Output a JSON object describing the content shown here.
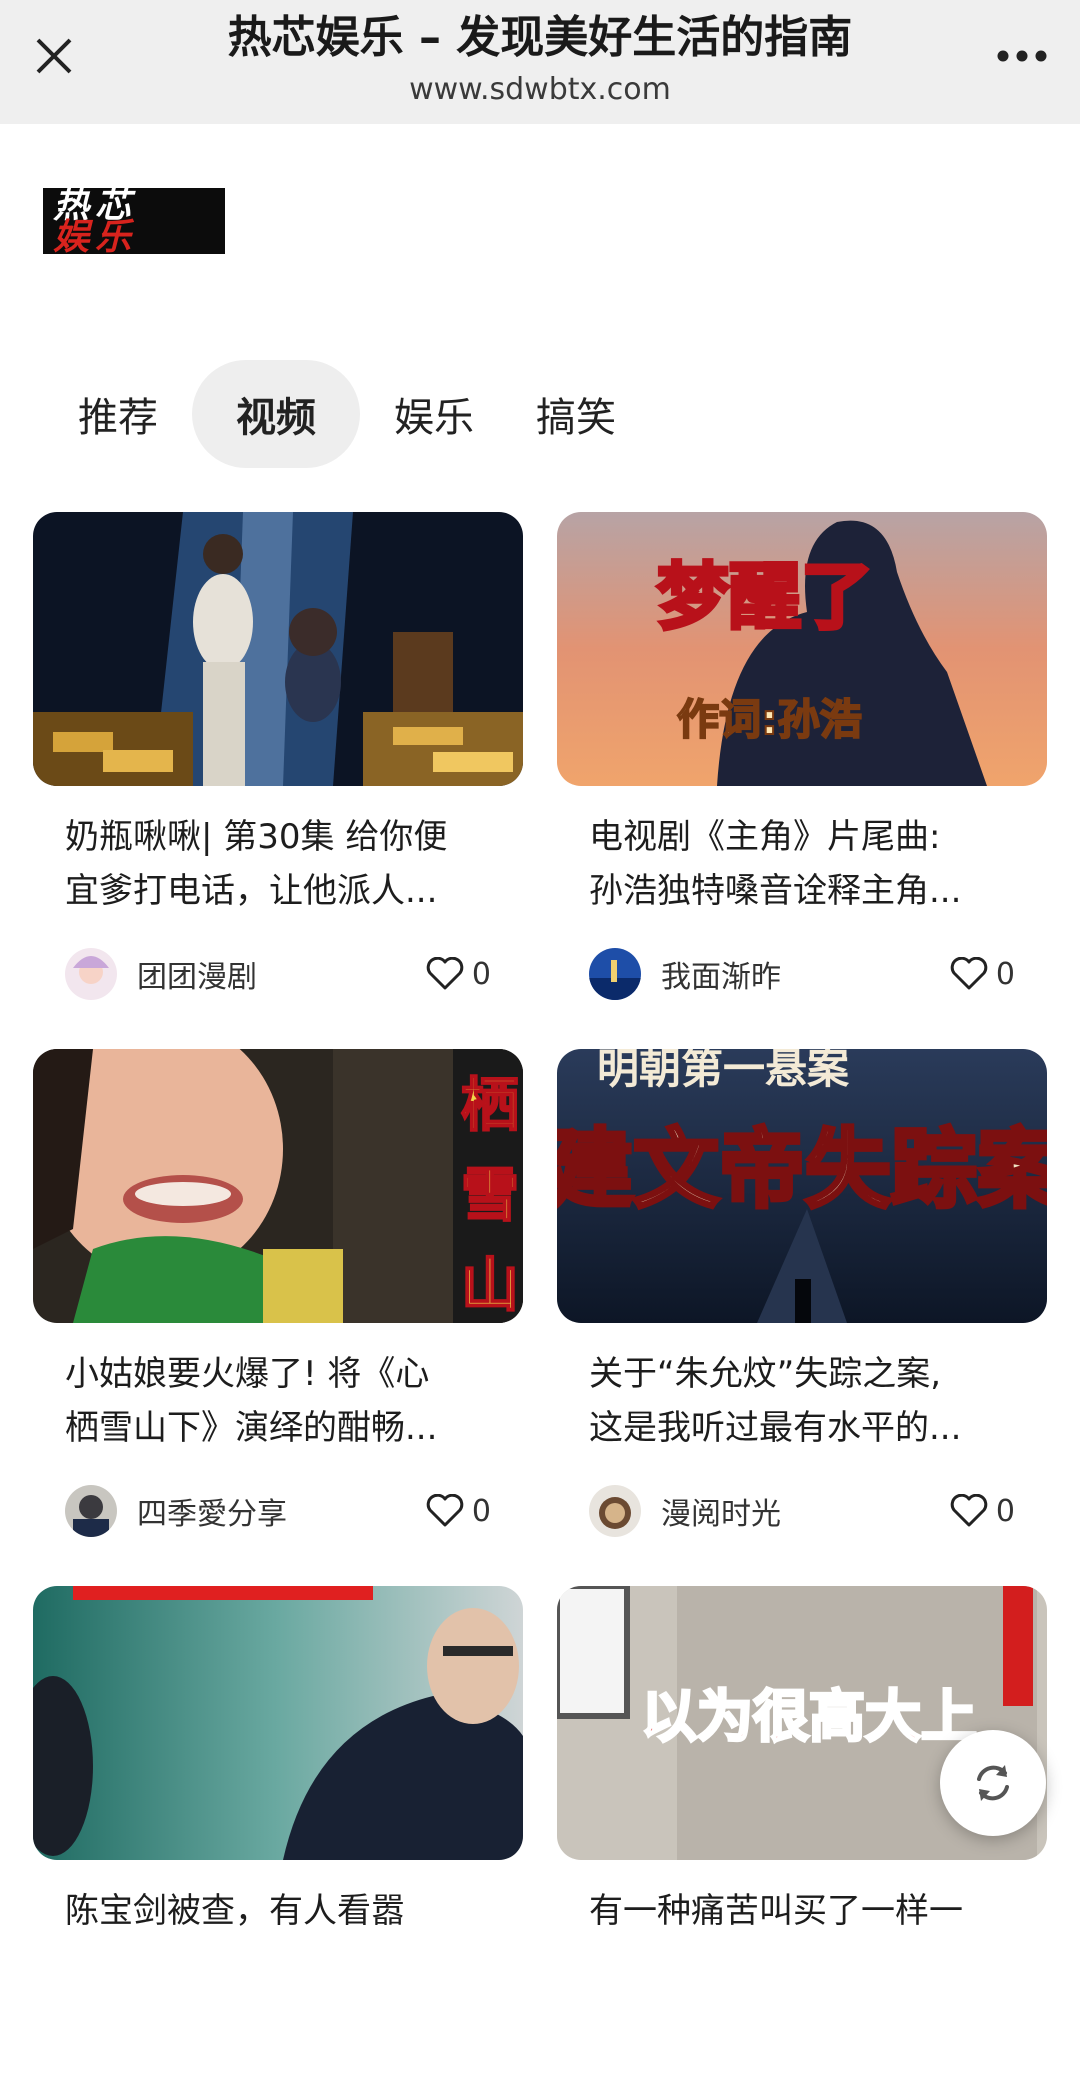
{
  "header": {
    "title": "热芯娱乐 – 发现美好生活的指南",
    "url": "www.sdwbtx.com",
    "close_icon": "close-icon",
    "more_icon": "more-dots-icon"
  },
  "logo": {
    "text_line1": "热芯",
    "text_line2": "娱乐"
  },
  "tabs": [
    {
      "label": "推荐",
      "active": false
    },
    {
      "label": "视频",
      "active": true
    },
    {
      "label": "娱乐",
      "active": false
    },
    {
      "label": "搞笑",
      "active": false
    }
  ],
  "cards": [
    {
      "title_line1": "奶瓶啾啾| 第30集 给你便",
      "title_line2": "宜爹打电话，让他派人...",
      "author": "团团漫剧",
      "likes": "0",
      "thumb_text": ""
    },
    {
      "title_line1": "电视剧《主角》片尾曲:",
      "title_line2": "孙浩独特嗓音诠释主角...",
      "author": "我面渐昨",
      "likes": "0",
      "thumb_text": "梦醒了",
      "thumb_subtext": "作词:孙浩"
    },
    {
      "title_line1": "小姑娘要火爆了! 将《心",
      "title_line2": "栖雪山下》演绎的酣畅...",
      "author": "四季愛分享",
      "likes": "0",
      "thumb_text": "栖雪山"
    },
    {
      "title_line1": "关于“朱允炆”失踪之案,",
      "title_line2": "这是我听过最有水平的...",
      "author": "漫阅时光",
      "likes": "0",
      "thumb_text": "建文帝失踪案",
      "thumb_subtext": "明朝第一悬案"
    },
    {
      "title_line1": "陈宝剑被查，有人看嚣",
      "title_line2": "",
      "author": "",
      "likes": "",
      "thumb_text": ""
    },
    {
      "title_line1": "有一种痛苦叫买了一样一",
      "title_line2": "",
      "author": "",
      "likes": "",
      "thumb_text": "以为很高大上"
    }
  ],
  "fab": {
    "icon": "refresh-icon"
  },
  "colors": {
    "topbar": "#efefef",
    "active_tab": "#eeeeee",
    "accent_red": "#d8231d"
  }
}
